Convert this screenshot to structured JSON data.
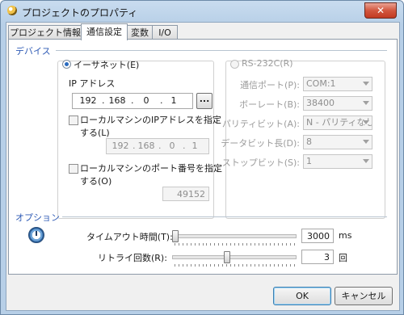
{
  "window": {
    "title": "プロジェクトのプロパティ",
    "close_symbol": "✕"
  },
  "tabs": [
    {
      "label": "プロジェクト情報"
    },
    {
      "label": "通信設定"
    },
    {
      "label": "変数"
    },
    {
      "label": "I/O"
    }
  ],
  "device": {
    "section_label": "デバイス",
    "ethernet": {
      "radio_label": "イーサネット(E)",
      "ip_label": "IP アドレス",
      "ip": [
        "192",
        "168",
        "0",
        "1"
      ],
      "browse_label": "...",
      "use_local_ip_label_1": "ローカルマシンのIPアドレスを指定",
      "use_local_ip_label_2": "する(L)",
      "local_ip": [
        "192",
        "168",
        "0",
        "1"
      ],
      "use_local_port_label_1": "ローカルマシンのポート番号を指定",
      "use_local_port_label_2": "する(O)",
      "local_port": "49152"
    },
    "rs232c": {
      "radio_label": "RS-232C(R)",
      "fields": [
        {
          "label": "通信ポート(P):",
          "value": "COM:1"
        },
        {
          "label": "ボーレート(B):",
          "value": "38400"
        },
        {
          "label": "パリティビット(A):",
          "value": "N - パリティなし"
        },
        {
          "label": "データビット長(D):",
          "value": "8"
        },
        {
          "label": "ストップビット(S):",
          "value": "1"
        }
      ]
    }
  },
  "options": {
    "section_label": "オプション",
    "timeout_label": "タイムアウト時間(T):",
    "timeout_value": "3000",
    "timeout_unit": "ms",
    "timeout_slider_fraction": 0.0,
    "retry_label": "リトライ回数(R):",
    "retry_value": "3",
    "retry_unit": "回",
    "retry_slider_fraction": 0.43
  },
  "footer": {
    "ok_label": "OK",
    "cancel_label": "キャンセル"
  }
}
